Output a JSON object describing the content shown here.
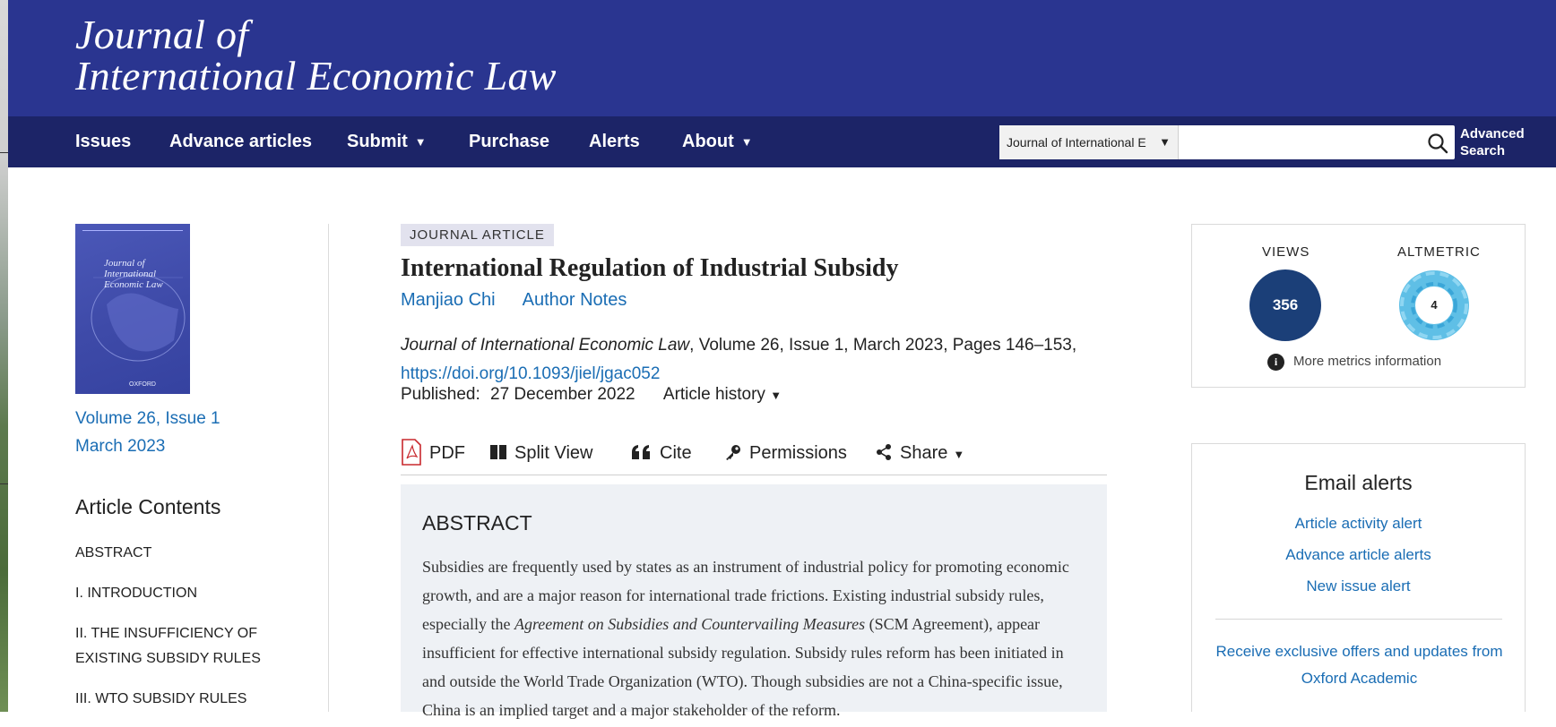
{
  "journal": {
    "logo_line1": "Journal of",
    "logo_line2": "International Economic Law"
  },
  "nav": {
    "items": [
      {
        "label": "Issues"
      },
      {
        "label": "Advance articles"
      },
      {
        "label": "Submit"
      },
      {
        "label": "Purchase"
      },
      {
        "label": "Alerts"
      },
      {
        "label": "About"
      }
    ],
    "search_scope": "Journal of International E",
    "search_value": "",
    "advanced_search_line1": "Advanced",
    "advanced_search_line2": "Search"
  },
  "issue": {
    "volume_issue": "Volume 26, Issue 1",
    "date": "March 2023"
  },
  "contents": {
    "title": "Article Contents",
    "items": [
      "ABSTRACT",
      "I. INTRODUCTION",
      "II. THE INSUFFICIENCY OF",
      "EXISTING SUBSIDY RULES",
      "III. WTO SUBSIDY RULES"
    ]
  },
  "article": {
    "tag": "JOURNAL ARTICLE",
    "title": "International Regulation of Industrial Subsidy",
    "author": "Manjiao Chi",
    "author_notes": "Author Notes",
    "journal_name": "Journal of International Economic Law",
    "citation_rest": ", Volume 26, Issue 1, March 2023, Pages 146–153,",
    "doi": "https://doi.org/10.1093/jiel/jgac052",
    "published_label": "Published:",
    "published_date": "27 December 2022",
    "history_label": "Article history"
  },
  "toolbar": {
    "pdf": "PDF",
    "split_view": "Split View",
    "cite": "Cite",
    "permissions": "Permissions",
    "share": "Share"
  },
  "abstract": {
    "heading": "ABSTRACT",
    "part1": "Subsidies are frequently used by states as an instrument of industrial policy for promoting economic growth, and are a major reason for international trade frictions. Existing industrial subsidy rules, especially the ",
    "italic": "Agreement on Subsidies and Countervailing Measures",
    "part2": " (SCM Agreement), appear insufficient for effective international subsidy regulation. Subsidy rules reform has been initiated in and outside the World Trade Organization (WTO). Though subsidies are not a China-specific issue, China is an implied target and a major stakeholder of the reform."
  },
  "metrics": {
    "views_label": "VIEWS",
    "views_value": "356",
    "altmetric_label": "ALTMETRIC",
    "altmetric_value": "4",
    "more_info": "More metrics information"
  },
  "alerts": {
    "title": "Email alerts",
    "links": [
      "Article activity alert",
      "Advance article alerts",
      "New issue alert"
    ],
    "offers": "Receive exclusive offers and updates from Oxford Academic"
  },
  "colors": {
    "brand_bar": "#2a3590",
    "nav_bar": "#1c2467",
    "link": "#1a6db4",
    "views_circle": "#1b3f78",
    "abstract_bg": "#eef1f5"
  }
}
